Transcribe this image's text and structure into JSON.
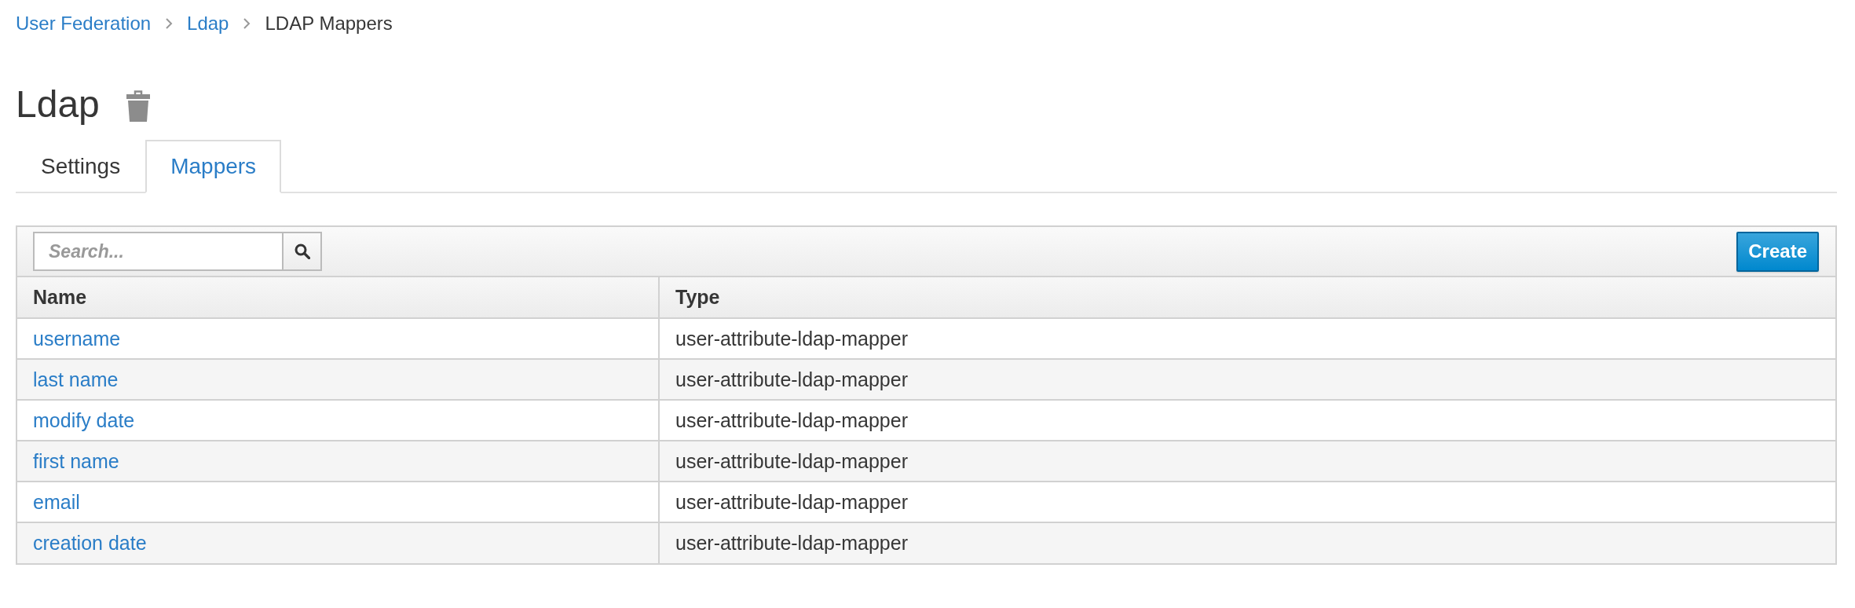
{
  "breadcrumb": [
    {
      "label": "User Federation",
      "kind": "link"
    },
    {
      "label": "Ldap",
      "kind": "link"
    },
    {
      "label": "LDAP Mappers",
      "kind": "current"
    }
  ],
  "page": {
    "title": "Ldap"
  },
  "tabs": [
    {
      "label": "Settings",
      "selected": false
    },
    {
      "label": "Mappers",
      "selected": true
    }
  ],
  "toolbar": {
    "search": {
      "placeholder": "Search..."
    },
    "create_button": "Create"
  },
  "table": {
    "columns": [
      "Name",
      "Type"
    ],
    "rows": [
      {
        "name": "username",
        "type": "user-attribute-ldap-mapper"
      },
      {
        "name": "last name",
        "type": "user-attribute-ldap-mapper"
      },
      {
        "name": "modify date",
        "type": "user-attribute-ldap-mapper"
      },
      {
        "name": "first name",
        "type": "user-attribute-ldap-mapper"
      },
      {
        "name": "email",
        "type": "user-attribute-ldap-mapper"
      },
      {
        "name": "creation date",
        "type": "user-attribute-ldap-mapper"
      }
    ]
  }
}
